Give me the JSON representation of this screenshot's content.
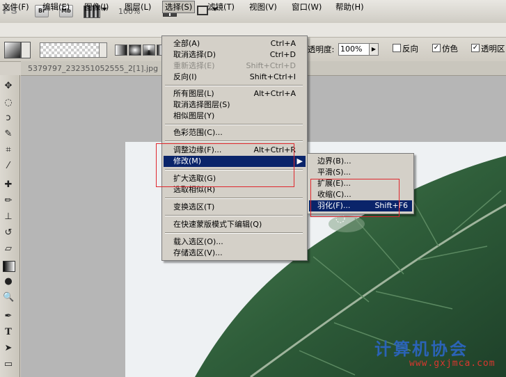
{
  "app": {
    "logo": "Ps",
    "bridge": "Br",
    "mini_bridge": "Mb",
    "zoom": "100%"
  },
  "menubar": [
    {
      "label": "文件(F)"
    },
    {
      "label": "编辑(E)"
    },
    {
      "label": "图像(I)"
    },
    {
      "label": "图层(L)"
    },
    {
      "label": "选择(S)"
    },
    {
      "label": "滤镜(T)"
    },
    {
      "label": "视图(V)"
    },
    {
      "label": "窗口(W)"
    },
    {
      "label": "帮助(H)"
    }
  ],
  "options": {
    "opacity_label": "透明度:",
    "opacity_value": "100%",
    "reverse_label": "反向",
    "dither_label": "仿色",
    "transparency_label": "透明区"
  },
  "document": {
    "tab_title": "5379797_232351052555_2[1].jpg"
  },
  "select_menu": {
    "items": [
      {
        "label": "全部(A)",
        "shortcut": "Ctrl+A"
      },
      {
        "label": "取消选择(D)",
        "shortcut": "Ctrl+D"
      },
      {
        "label": "重新选择(E)",
        "shortcut": "Shift+Ctrl+D",
        "disabled": true
      },
      {
        "label": "反向(I)",
        "shortcut": "Shift+Ctrl+I"
      },
      {
        "label": "所有图层(L)",
        "shortcut": "Alt+Ctrl+A"
      },
      {
        "label": "取消选择图层(S)",
        "shortcut": ""
      },
      {
        "label": "相似图层(Y)",
        "shortcut": ""
      },
      {
        "label": "色彩范围(C)...",
        "shortcut": ""
      },
      {
        "label": "调整边缘(F)...",
        "shortcut": "Alt+Ctrl+R"
      },
      {
        "label": "修改(M)",
        "shortcut": ""
      },
      {
        "label": "扩大选取(G)",
        "shortcut": ""
      },
      {
        "label": "选取相似(R)",
        "shortcut": ""
      },
      {
        "label": "变换选区(T)",
        "shortcut": ""
      },
      {
        "label": "在快速蒙版模式下编辑(Q)",
        "shortcut": ""
      },
      {
        "label": "载入选区(O)...",
        "shortcut": ""
      },
      {
        "label": "存储选区(V)...",
        "shortcut": ""
      }
    ]
  },
  "modify_submenu": {
    "items": [
      {
        "label": "边界(B)...",
        "shortcut": ""
      },
      {
        "label": "平滑(S)...",
        "shortcut": ""
      },
      {
        "label": "扩展(E)...",
        "shortcut": ""
      },
      {
        "label": "收缩(C)...",
        "shortcut": ""
      },
      {
        "label": "羽化(F)...",
        "shortcut": "Shift+F6"
      }
    ]
  },
  "watermark": {
    "title": "计算机协会",
    "url": "www.gxjmca.com"
  },
  "colors": {
    "menu_highlight": "#0a246a",
    "annotation_red": "#e0262c",
    "leaf_green": "#2f5e3a"
  }
}
